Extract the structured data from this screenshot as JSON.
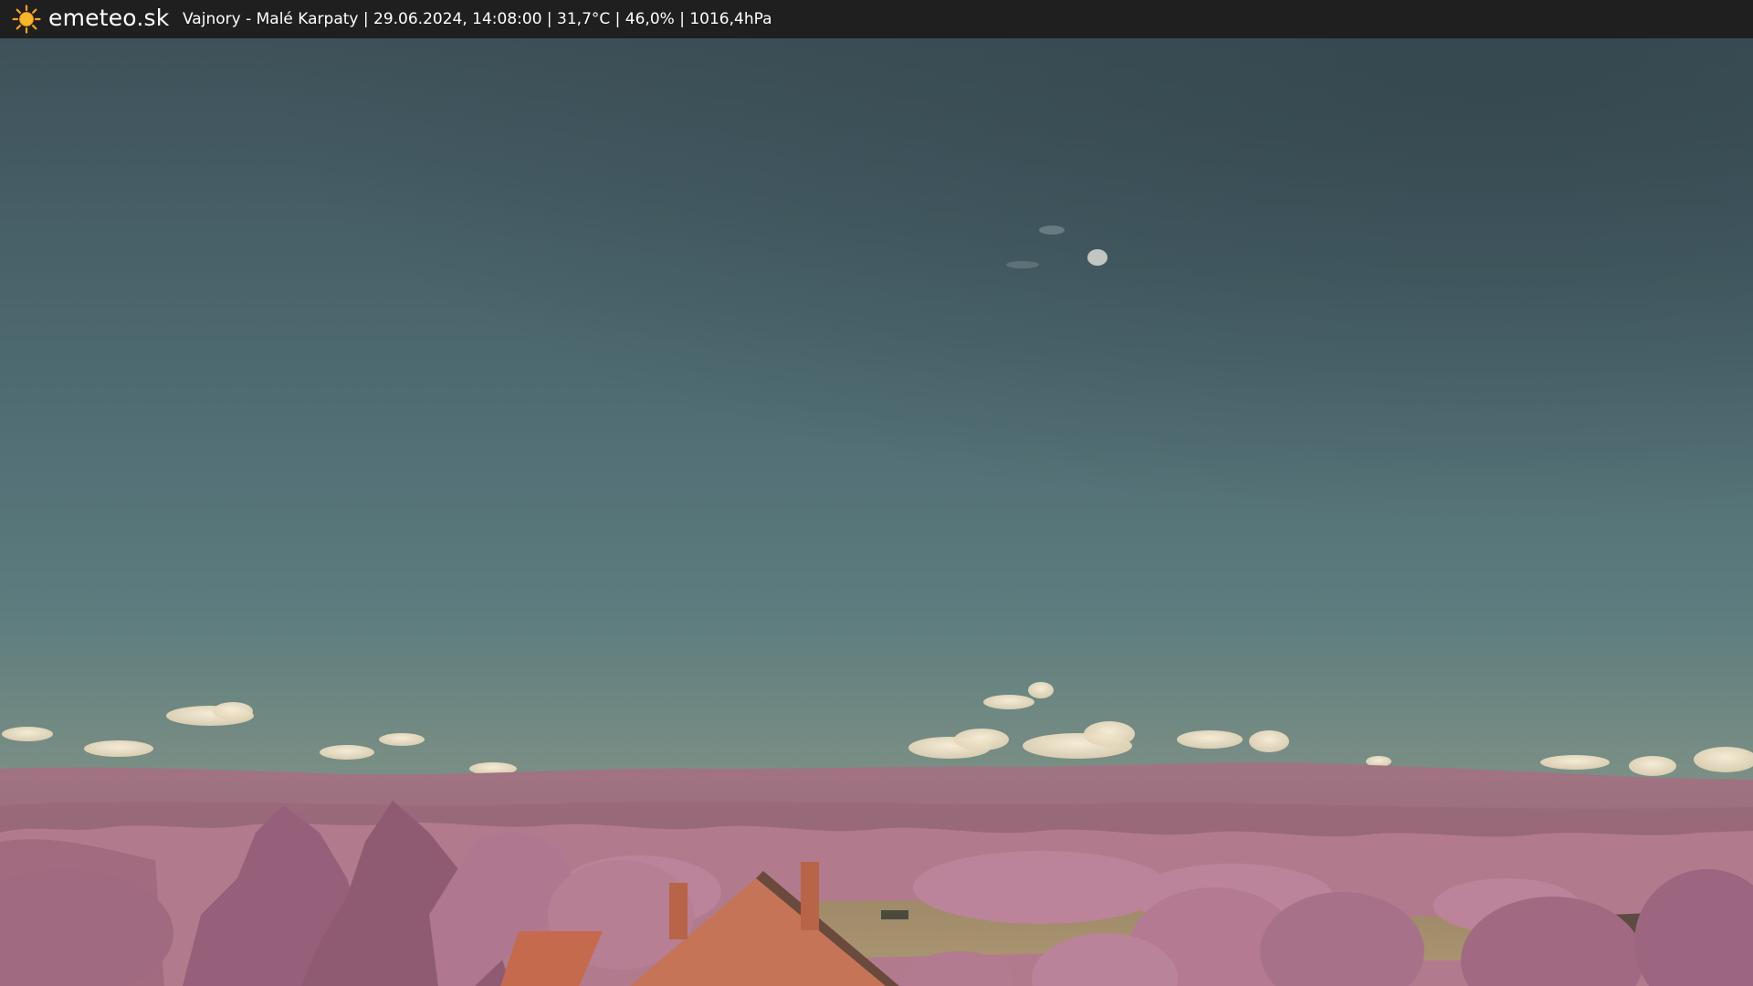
{
  "brand": {
    "logo_icon": "sun-icon",
    "name": "emeteo.sk"
  },
  "caption": "Vajnory - Malé Karpaty | 29.06.2024, 14:08:00 | 31,7°C | 46,0% | 1016,4hPa",
  "colors": {
    "topbar": "#1f1f1f",
    "sun": "#f5a623",
    "sky_top": "#3d525b",
    "sky_mid": "#5a7a7e",
    "horizon": "#c7b79b",
    "hills": "#9c6e80",
    "foliage": "#b3788e",
    "field": "#a18f6d",
    "roof": "#c06a4f"
  }
}
